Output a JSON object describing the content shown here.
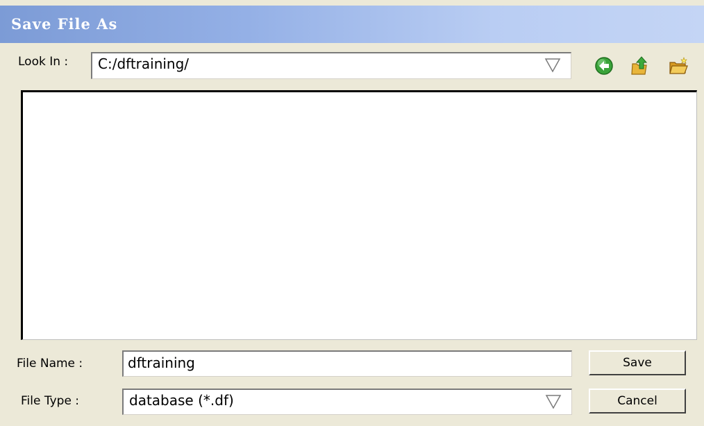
{
  "window": {
    "title": "Save File As"
  },
  "look_in": {
    "label": "Look In :",
    "value": "C:/dftraining/"
  },
  "toolbar": {
    "icons": [
      "back-arrow-icon",
      "up-folder-icon",
      "new-folder-icon"
    ]
  },
  "file_name": {
    "label": "File Name :",
    "value": "dftraining"
  },
  "file_type": {
    "label": "File Type :",
    "value": "database (*.df)"
  },
  "buttons": {
    "save_label": "Save",
    "cancel_label": "Cancel"
  },
  "colors": {
    "titlebar_start": "#7c9bd6",
    "titlebar_end": "#c4d5f5",
    "dialog_bg": "#ece9d8"
  }
}
